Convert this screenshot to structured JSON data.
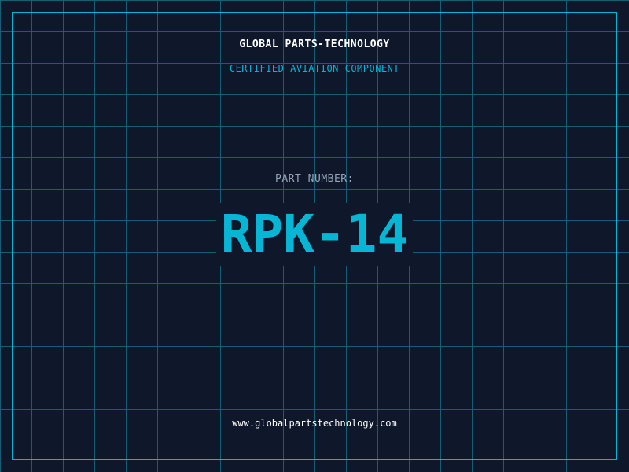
{
  "header": {
    "company": "GLOBAL PARTS-TECHNOLOGY",
    "subtitle": "CERTIFIED AVIATION COMPONENT"
  },
  "part": {
    "label": "PART NUMBER:",
    "number": "RPK-14"
  },
  "footer": {
    "url": "www.globalpartstechnology.com"
  },
  "colors": {
    "background": "#0f172a",
    "accent": "#06b6d4",
    "grid": "#155e75"
  }
}
